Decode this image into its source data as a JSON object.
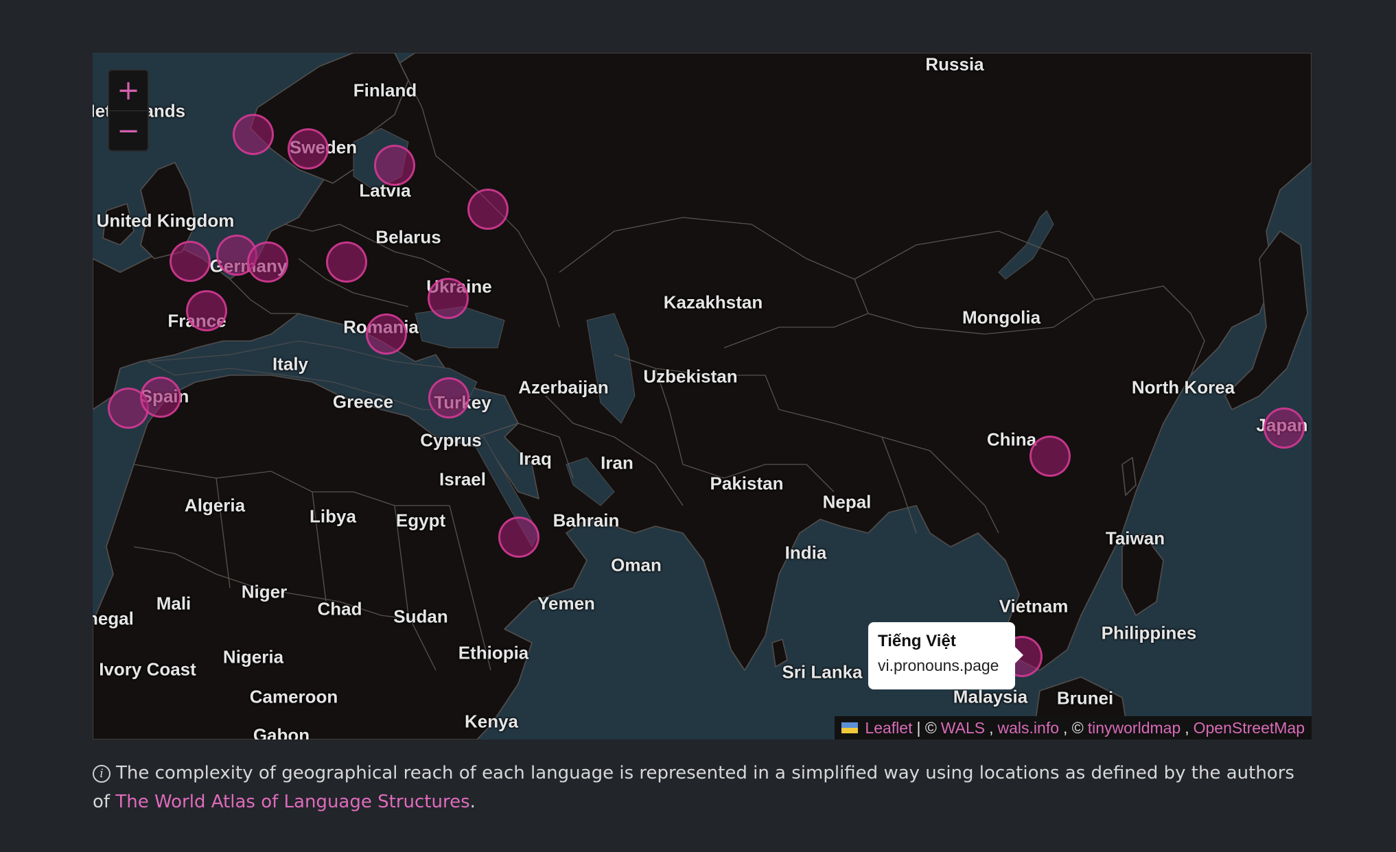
{
  "map": {
    "zoom_in": "+",
    "zoom_out": "−",
    "labels": [
      {
        "id": "russia",
        "text": "Russia"
      },
      {
        "id": "finland",
        "text": "Finland"
      },
      {
        "id": "netherlands",
        "text": "Netherlands"
      },
      {
        "id": "sweden",
        "text": "Sweden"
      },
      {
        "id": "latvia",
        "text": "Latvia"
      },
      {
        "id": "united-kingdom",
        "text": "United Kingdom"
      },
      {
        "id": "belarus",
        "text": "Belarus"
      },
      {
        "id": "germany",
        "text": "Germany"
      },
      {
        "id": "ukraine",
        "text": "Ukraine"
      },
      {
        "id": "france",
        "text": "France"
      },
      {
        "id": "romania",
        "text": "Romania"
      },
      {
        "id": "italy",
        "text": "Italy"
      },
      {
        "id": "spain",
        "text": "Spain"
      },
      {
        "id": "greece",
        "text": "Greece"
      },
      {
        "id": "turkey",
        "text": "Turkey"
      },
      {
        "id": "azerbaijan",
        "text": "Azerbaijan"
      },
      {
        "id": "cyprus",
        "text": "Cyprus"
      },
      {
        "id": "kazakhstan",
        "text": "Kazakhstan"
      },
      {
        "id": "uzbekistan",
        "text": "Uzbekistan"
      },
      {
        "id": "mongolia",
        "text": "Mongolia"
      },
      {
        "id": "north-korea",
        "text": "North Korea"
      },
      {
        "id": "japan",
        "text": "Japan"
      },
      {
        "id": "china",
        "text": "China"
      },
      {
        "id": "iraq",
        "text": "Iraq"
      },
      {
        "id": "iran",
        "text": "Iran"
      },
      {
        "id": "israel",
        "text": "Israel"
      },
      {
        "id": "pakistan",
        "text": "Pakistan"
      },
      {
        "id": "nepal",
        "text": "Nepal"
      },
      {
        "id": "algeria",
        "text": "Algeria"
      },
      {
        "id": "libya",
        "text": "Libya"
      },
      {
        "id": "egypt",
        "text": "Egypt"
      },
      {
        "id": "bahrain",
        "text": "Bahrain"
      },
      {
        "id": "oman",
        "text": "Oman"
      },
      {
        "id": "india",
        "text": "India"
      },
      {
        "id": "taiwan",
        "text": "Taiwan"
      },
      {
        "id": "mali",
        "text": "Mali"
      },
      {
        "id": "niger",
        "text": "Niger"
      },
      {
        "id": "chad",
        "text": "Chad"
      },
      {
        "id": "sudan",
        "text": "Sudan"
      },
      {
        "id": "yemen",
        "text": "Yemen"
      },
      {
        "id": "vietnam",
        "text": "Vietnam"
      },
      {
        "id": "philippines",
        "text": "Philippines"
      },
      {
        "id": "senegal",
        "text": "Senegal"
      },
      {
        "id": "ivory-coast",
        "text": "Ivory Coast"
      },
      {
        "id": "nigeria",
        "text": "Nigeria"
      },
      {
        "id": "ethiopia",
        "text": "Ethiopia"
      },
      {
        "id": "sri-lanka",
        "text": "Sri Lanka"
      },
      {
        "id": "cameroon",
        "text": "Cameroon"
      },
      {
        "id": "malaysia",
        "text": "Malaysia"
      },
      {
        "id": "brunei",
        "text": "Brunei"
      },
      {
        "id": "kenya",
        "text": "Kenya"
      },
      {
        "id": "gabon",
        "text": "Gabon"
      }
    ],
    "popup": {
      "title": "Tiếng Việt",
      "subtitle": "vi.pronouns.page"
    },
    "attribution": {
      "leaflet": "Leaflet",
      "sep1": "| ©",
      "wals": "WALS",
      "comma1": ",",
      "walsinfo": "wals.info",
      "sep2": ", ©",
      "tinyworldmap": "tinyworldmap",
      "comma2": ",",
      "osm": "OpenStreetMap"
    }
  },
  "note": {
    "icon": "i",
    "text": "The complexity of geographical reach of each language is represented in a simplified way using locations as defined by the authors of ",
    "link": "The World Atlas of Language Structures",
    "end": "."
  },
  "colors": {
    "accent": "#d86bb9",
    "marker_fill": "#9e1e6e",
    "background": "#22252a",
    "water": "#233743",
    "land": "#13100f"
  }
}
